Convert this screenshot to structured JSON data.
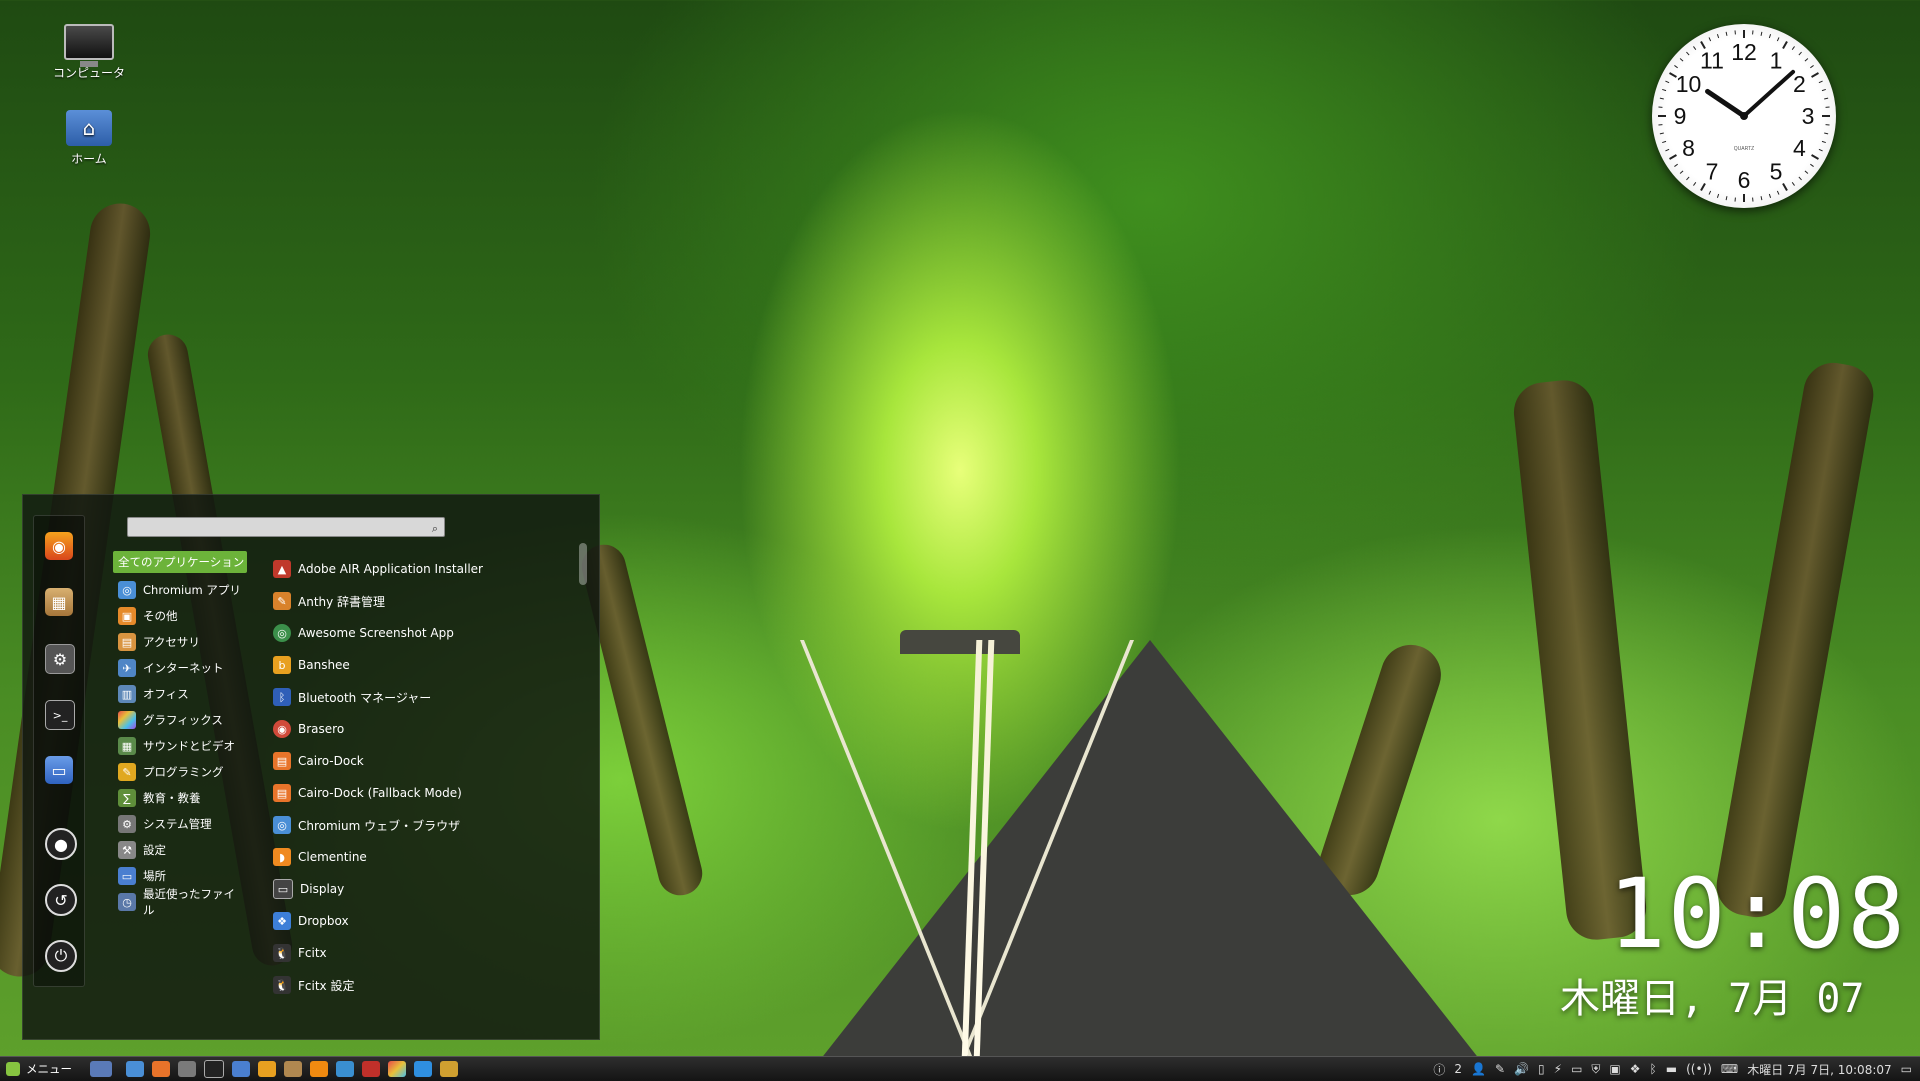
{
  "desktop": {
    "icons": [
      {
        "label": "コンピュータ",
        "icon": "computer-icon"
      },
      {
        "label": "ホーム",
        "icon": "home-folder-icon"
      }
    ]
  },
  "clock_widget": {
    "numerals": [
      "12",
      "1",
      "2",
      "3",
      "4",
      "5",
      "6",
      "7",
      "8",
      "9",
      "10",
      "11"
    ],
    "brand": "QUARTZ",
    "time": "10:08"
  },
  "digital_clock": {
    "time": "10:08",
    "date": "木曜日, 7月 07"
  },
  "menu": {
    "search": {
      "value": "",
      "placeholder": ""
    },
    "favorites": [
      "firefox-icon",
      "package-icon",
      "system-settings-icon",
      "terminal-icon",
      "folder-icon",
      "lock-screen-icon",
      "logout-icon",
      "power-icon"
    ],
    "categories": [
      {
        "label": "全てのアプリケーション",
        "selected": true,
        "icon": "all-apps-icon",
        "color": "#6cb33a"
      },
      {
        "label": "Chromium アプリ",
        "icon": "chromium-icon",
        "color": "#4a8fd6"
      },
      {
        "label": "その他",
        "icon": "other-icon",
        "color": "#e58a2a"
      },
      {
        "label": "アクセサリ",
        "icon": "accessories-icon",
        "color": "#d89440"
      },
      {
        "label": "インターネット",
        "icon": "internet-icon",
        "color": "#4f86c6"
      },
      {
        "label": "オフィス",
        "icon": "office-icon",
        "color": "#5d88b8"
      },
      {
        "label": "グラフィックス",
        "icon": "graphics-icon",
        "color": "#d64aa0"
      },
      {
        "label": "サウンドとビデオ",
        "icon": "sound-video-icon",
        "color": "#5a8a4a"
      },
      {
        "label": "プログラミング",
        "icon": "programming-icon",
        "color": "#e0a820"
      },
      {
        "label": "教育・教養",
        "icon": "education-icon",
        "color": "#5f8f3a"
      },
      {
        "label": "システム管理",
        "icon": "system-admin-icon",
        "color": "#777777"
      },
      {
        "label": "設定",
        "icon": "settings-icon",
        "color": "#888888"
      },
      {
        "label": "場所",
        "icon": "places-icon",
        "color": "#4a7fd0"
      },
      {
        "label": "最近使ったファイル",
        "icon": "recent-files-icon",
        "color": "#5a78a8"
      }
    ],
    "applications": [
      {
        "label": "Adobe AIR Application Installer",
        "icon": "adobe-air-icon",
        "color": "#c0392b"
      },
      {
        "label": "Anthy 辞書管理",
        "icon": "anthy-icon",
        "color": "#d9822b"
      },
      {
        "label": "Awesome Screenshot App",
        "icon": "awesome-screenshot-icon",
        "color": "#3b8f4a"
      },
      {
        "label": "Banshee",
        "icon": "banshee-icon",
        "color": "#e8a020"
      },
      {
        "label": "Bluetooth マネージャー",
        "icon": "bluetooth-icon",
        "color": "#2f5fb8"
      },
      {
        "label": "Brasero",
        "icon": "brasero-icon",
        "color": "#d04a3a"
      },
      {
        "label": "Cairo-Dock",
        "icon": "cairo-dock-icon",
        "color": "#e8742a"
      },
      {
        "label": "Cairo-Dock (Fallback Mode)",
        "icon": "cairo-dock-fallback-icon",
        "color": "#e8742a"
      },
      {
        "label": "Chromium ウェブ・ブラウザ",
        "icon": "chromium-browser-icon",
        "color": "#4a8fd6"
      },
      {
        "label": "Clementine",
        "icon": "clementine-icon",
        "color": "#f08a20"
      },
      {
        "label": "Display",
        "icon": "display-icon",
        "color": "#444444"
      },
      {
        "label": "Dropbox",
        "icon": "dropbox-icon",
        "color": "#3d7fd8"
      },
      {
        "label": "Fcitx",
        "icon": "fcitx-icon",
        "color": "#333333"
      },
      {
        "label": "Fcitx 設定",
        "icon": "fcitx-settings-icon",
        "color": "#333333"
      }
    ]
  },
  "taskbar": {
    "menu_label": "メニュー",
    "launchers": [
      "show-desktop-icon",
      "chromium-icon",
      "firefox-icon",
      "screenshot-icon",
      "terminal-icon",
      "files-icon",
      "text-editor-icon",
      "archive-icon",
      "vlc-icon",
      "paint-icon",
      "red-app-icon",
      "color-app-icon",
      "store-icon",
      "network-icon"
    ],
    "workspace_count": "2",
    "clock": "木曜日 7月  7日, 10:08:07"
  }
}
